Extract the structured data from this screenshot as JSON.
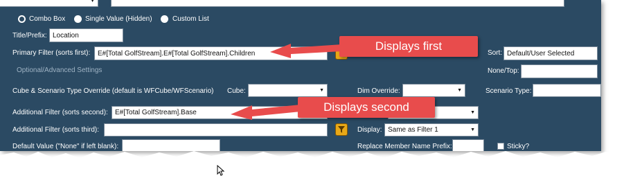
{
  "options": {
    "combo_box": "Combo Box",
    "single_value": "Single Value (Hidden)",
    "custom_list": "Custom List",
    "selected": "combo_box"
  },
  "title_prefix": {
    "label": "Title/Prefix:",
    "value": "Location"
  },
  "primary_filter": {
    "label": "Primary Filter (sorts first):",
    "value": "E#[Total GolfStream].E#[Total GolfStream].Children"
  },
  "sort": {
    "label": "Sort:",
    "value": "Default/User Selected"
  },
  "optional_settings": "Optional/Advanced Settings",
  "none_top": {
    "label": "None/Top:",
    "value": ""
  },
  "cube_scenario": {
    "label": "Cube & Scenario Type Override (default is WFCube/WFScenario)"
  },
  "cube": {
    "label": "Cube:",
    "value": ""
  },
  "dim_override": {
    "label": "Dim Override:",
    "value": ""
  },
  "scenario_type": {
    "label": "Scenario Type:",
    "value": ""
  },
  "additional_filter_2": {
    "label": "Additional Filter (sorts second):",
    "value": "E#[Total GolfStream].Base"
  },
  "additional_filter_3": {
    "label": "Additional Filter (sorts third):",
    "value": ""
  },
  "display": {
    "label": "Display:",
    "value": "Same as Filter 1"
  },
  "default_value": {
    "label": "Default Value (\"None\" if left blank):",
    "value": ""
  },
  "replace_prefix": {
    "label": "Replace Member Name Prefix:",
    "value": ""
  },
  "sticky": {
    "label": "Sticky?"
  },
  "callouts": {
    "first": "Displays first",
    "second": "Displays second"
  },
  "colors": {
    "panel": "#2b4a63",
    "callout": "#e84c4c",
    "filter_icon": "#e8a818"
  }
}
